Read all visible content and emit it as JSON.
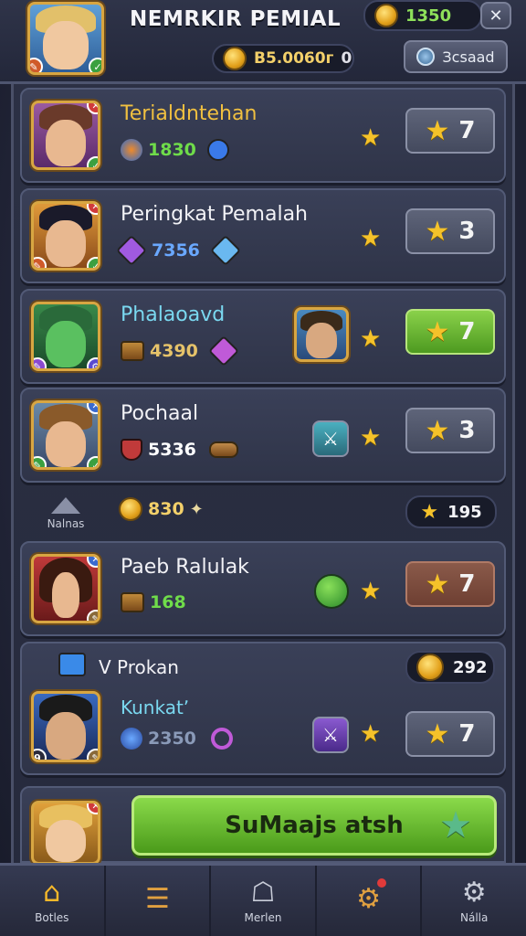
{
  "header": {
    "title": "NEMRKIR PEMIAL",
    "coins_top": "1350",
    "balance": "B5.0060г",
    "balance_suffix": "0",
    "account_button": "Зcsaad"
  },
  "rows": [
    {
      "name": "Terialdntehan",
      "stat": "1830",
      "rank": "7",
      "rank_style": "grey",
      "name_color": "#f0c040",
      "stat_color": "#6fdc4a"
    },
    {
      "name": "Peringkat Pemalah",
      "stat": "7356",
      "rank": "3",
      "rank_style": "grey",
      "name_color": "#f2f2f6",
      "stat_color": "#6aa8ff"
    },
    {
      "name": "Phalaoavd",
      "stat": "4390",
      "rank": "7",
      "rank_style": "green",
      "name_color": "#7ad8f0",
      "stat_color": "#e6c36a"
    },
    {
      "name": "Pochaal",
      "stat": "5336",
      "rank": "3",
      "rank_style": "grey",
      "name_color": "#f2f2f6",
      "stat_color": "#ffffff"
    }
  ],
  "divider": {
    "left_label": "Nalnas",
    "coins": "830",
    "star_count": "195"
  },
  "rows2": [
    {
      "name": "Paeb Ralulak",
      "stat": "168",
      "rank": "7",
      "rank_style": "red",
      "name_color": "#f2f2f6",
      "stat_color": "#6fdc4a"
    }
  ],
  "group": {
    "title": "V Prokan",
    "coins": "292",
    "sub_name": "Kunkatʼ",
    "sub_stat": "2350",
    "sub_rank": "7"
  },
  "cta": {
    "label": "SuMaajs atsh"
  },
  "nav": [
    {
      "label": "Botles",
      "icon": "home-icon",
      "glyph": "⌂"
    },
    {
      "label": "",
      "icon": "list-icon",
      "glyph": "☰"
    },
    {
      "label": "Merlen",
      "icon": "shop-icon",
      "glyph": "☖"
    },
    {
      "label": "",
      "icon": "gear-alert-icon",
      "glyph": "⚙"
    },
    {
      "label": "Nálla",
      "icon": "settings-icon",
      "glyph": "⚙"
    }
  ],
  "colors": {
    "accent_gold": "#f5c22a",
    "cta_green": "#6cc23a",
    "rank_green": "#6cc03a",
    "rank_red": "#7a4a3c"
  }
}
